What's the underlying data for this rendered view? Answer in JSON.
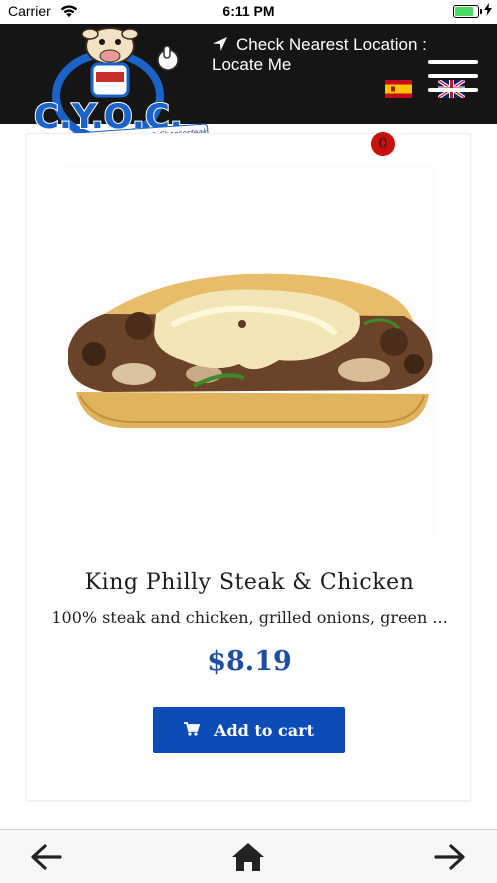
{
  "statusbar": {
    "carrier": "Carrier",
    "time": "6:11 PM",
    "battery_level": 0.85
  },
  "header": {
    "logo_text": "C.Y.O.C.",
    "logo_tagline": "Create Your Own Cheesecake & Cheesesteak",
    "locate_line1": "Check Nearest Location :",
    "locate_line2": "Locate Me",
    "cart_count": "0"
  },
  "product": {
    "name": "King Philly Steak & Chicken",
    "description": "100% steak and chicken, grilled onions, green ...",
    "price": "$8.19",
    "add_to_cart_label": "Add to cart"
  },
  "colors": {
    "header_bg": "#151515",
    "accent_blue": "#0c4cb6",
    "price_blue": "#1d4ea3",
    "badge_red": "#c8110d"
  },
  "icons": {
    "back": "arrow-left-icon",
    "home": "home-icon",
    "forward": "arrow-right-icon",
    "menu": "hamburger-icon",
    "locate": "location-arrow-icon",
    "cart": "shopping-cart-icon"
  }
}
